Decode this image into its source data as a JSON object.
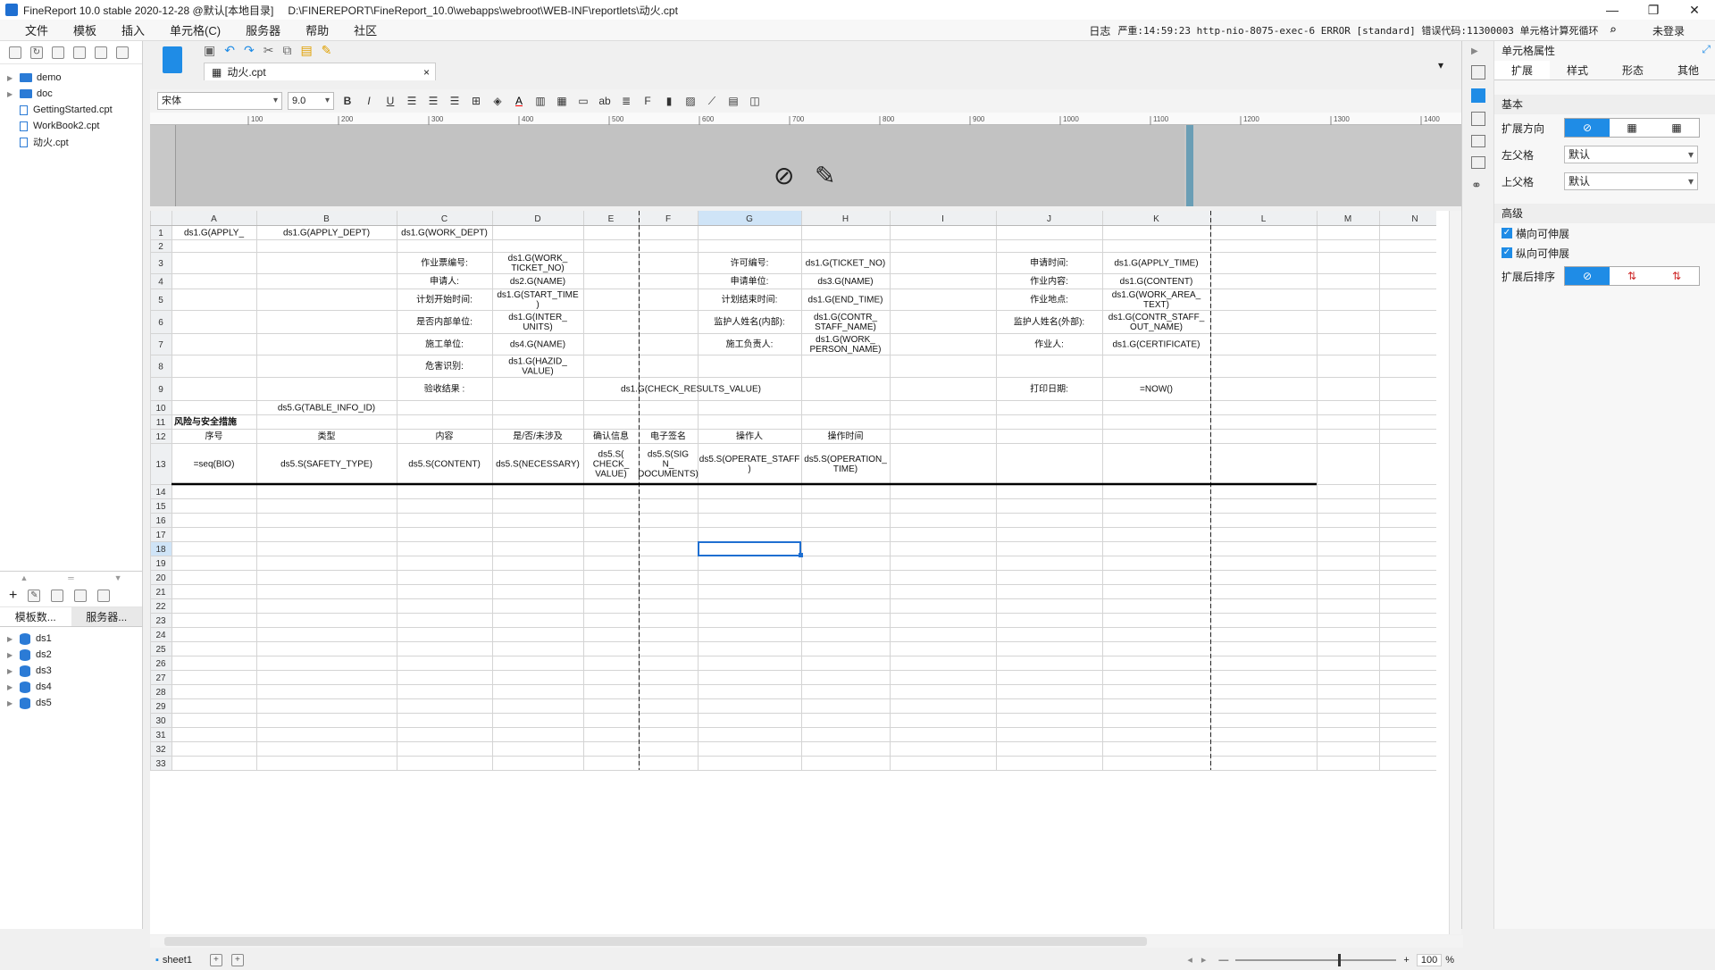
{
  "app": {
    "title": "FineReport 10.0 stable 2020-12-28 @默认[本地目录]",
    "path": "D:\\FINEREPORT\\FineReport_10.0\\webapps\\webroot\\WEB-INF\\reportlets\\动火.cpt"
  },
  "menu": [
    "文件",
    "模板",
    "插入",
    "单元格(C)",
    "服务器",
    "帮助",
    "社区"
  ],
  "status": {
    "log": "日志",
    "message": "严重:14:59:23 http-nio-8075-exec-6 ERROR [standard] 错误代码:11300003 单元格计算死循环",
    "login": "未登录"
  },
  "tree": [
    {
      "type": "folder",
      "label": "demo"
    },
    {
      "type": "folder",
      "label": "doc"
    },
    {
      "type": "file",
      "label": "GettingStarted.cpt"
    },
    {
      "type": "file",
      "label": "WorkBook2.cpt"
    },
    {
      "type": "file",
      "label": "动火.cpt"
    }
  ],
  "bottomTabs": [
    "模板数...",
    "服务器..."
  ],
  "datasets": [
    "ds1",
    "ds2",
    "ds3",
    "ds4",
    "ds5"
  ],
  "doc": {
    "tab": "动火.cpt",
    "close": "×"
  },
  "format": {
    "font": "宋体",
    "size": "9.0"
  },
  "ruler": [
    "100",
    "200",
    "300",
    "400",
    "500",
    "600",
    "700",
    "800",
    "900",
    "1000",
    "1100",
    "1200",
    "1300",
    "1400"
  ],
  "grid": {
    "columns": [
      "A",
      "B",
      "C",
      "D",
      "E",
      "F",
      "G",
      "H",
      "I",
      "J",
      "K",
      "L",
      "M",
      "N"
    ],
    "rows": [
      "1",
      "2",
      "3",
      "4",
      "5",
      "6",
      "7",
      "8",
      "9",
      "10",
      "11",
      "12",
      "13",
      "14",
      "15",
      "16",
      "17",
      "18",
      "19",
      "20",
      "21",
      "22",
      "23",
      "24",
      "25",
      "26",
      "27",
      "28",
      "29",
      "30",
      "31",
      "32",
      "33"
    ],
    "cells": [
      {
        "r": 0,
        "c": 0,
        "t": "ds1.G(APPLY_"
      },
      {
        "r": 0,
        "c": 1,
        "t": "ds1.G(APPLY_DEPT)"
      },
      {
        "r": 0,
        "c": 2,
        "t": "ds1.G(WORK_DEPT)"
      },
      {
        "r": 2,
        "c": 2,
        "t": "作业票编号:"
      },
      {
        "r": 2,
        "c": 3,
        "t": "ds1.G(WORK_|TICKET_NO)"
      },
      {
        "r": 2,
        "c": 6,
        "t": "许可编号:"
      },
      {
        "r": 2,
        "c": 7,
        "t": "ds1.G(TICKET_NO)"
      },
      {
        "r": 2,
        "c": 9,
        "t": "申请时间:"
      },
      {
        "r": 2,
        "c": 10,
        "t": "ds1.G(APPLY_TIME)"
      },
      {
        "r": 3,
        "c": 2,
        "t": "申请人:"
      },
      {
        "r": 3,
        "c": 3,
        "t": "ds2.G(NAME)"
      },
      {
        "r": 3,
        "c": 6,
        "t": "申请单位:"
      },
      {
        "r": 3,
        "c": 7,
        "t": "ds3.G(NAME)"
      },
      {
        "r": 3,
        "c": 9,
        "t": "作业内容:"
      },
      {
        "r": 3,
        "c": 10,
        "t": "ds1.G(CONTENT)"
      },
      {
        "r": 4,
        "c": 2,
        "t": "计划开始时间:"
      },
      {
        "r": 4,
        "c": 3,
        "t": "ds1.G(START_TIME|)"
      },
      {
        "r": 4,
        "c": 6,
        "t": "计划结束时间:"
      },
      {
        "r": 4,
        "c": 7,
        "t": "ds1.G(END_TIME)"
      },
      {
        "r": 4,
        "c": 9,
        "t": "作业地点:"
      },
      {
        "r": 4,
        "c": 10,
        "t": "ds1.G(WORK_AREA_|TEXT)"
      },
      {
        "r": 5,
        "c": 2,
        "t": "是否内部单位:"
      },
      {
        "r": 5,
        "c": 3,
        "t": "ds1.G(INTER_|UNITS)"
      },
      {
        "r": 5,
        "c": 6,
        "t": "监护人姓名(内部):"
      },
      {
        "r": 5,
        "c": 7,
        "t": "ds1.G(CONTR_|STAFF_NAME)"
      },
      {
        "r": 5,
        "c": 9,
        "t": "监护人姓名(外部):"
      },
      {
        "r": 5,
        "c": 10,
        "t": "ds1.G(CONTR_STAFF_|OUT_NAME)"
      },
      {
        "r": 6,
        "c": 2,
        "t": "施工单位:"
      },
      {
        "r": 6,
        "c": 3,
        "t": "ds4.G(NAME)"
      },
      {
        "r": 6,
        "c": 6,
        "t": "施工负责人:"
      },
      {
        "r": 6,
        "c": 7,
        "t": "ds1.G(WORK_|PERSON_NAME)"
      },
      {
        "r": 6,
        "c": 9,
        "t": "作业人:"
      },
      {
        "r": 6,
        "c": 10,
        "t": "ds1.G(CERTIFICATE)"
      },
      {
        "r": 7,
        "c": 2,
        "t": "危害识别:"
      },
      {
        "r": 7,
        "c": 3,
        "t": "ds1.G(HAZID_|VALUE)"
      },
      {
        "r": 8,
        "c": 2,
        "t": "验收结果 :"
      },
      {
        "r": 8,
        "c": 3,
        "t": "ds1.G(CHECK_RESULTS_VALUE)",
        "span": 5
      },
      {
        "r": 8,
        "c": 9,
        "t": "打印日期:"
      },
      {
        "r": 8,
        "c": 10,
        "t": "=NOW()"
      },
      {
        "r": 9,
        "c": 1,
        "t": "ds5.G(TABLE_INFO_ID)"
      },
      {
        "r": 10,
        "c": 0,
        "t": "风险与安全措施",
        "bold": true,
        "left": true
      },
      {
        "r": 11,
        "c": 0,
        "t": "序号"
      },
      {
        "r": 11,
        "c": 1,
        "t": "类型"
      },
      {
        "r": 11,
        "c": 2,
        "t": "内容"
      },
      {
        "r": 11,
        "c": 3,
        "t": "是/否/未涉及"
      },
      {
        "r": 11,
        "c": 4,
        "t": "确认信息"
      },
      {
        "r": 11,
        "c": 5,
        "t": "电子签名"
      },
      {
        "r": 11,
        "c": 6,
        "t": "操作人"
      },
      {
        "r": 11,
        "c": 7,
        "t": "操作时间"
      },
      {
        "r": 12,
        "c": 0,
        "t": "=seq(BIO)"
      },
      {
        "r": 12,
        "c": 1,
        "t": "ds5.S(SAFETY_TYPE)"
      },
      {
        "r": 12,
        "c": 2,
        "t": "ds5.S(CONTENT)"
      },
      {
        "r": 12,
        "c": 3,
        "t": "ds5.S(NECESSARY)"
      },
      {
        "r": 12,
        "c": 4,
        "t": "ds5.S(|CHECK_|VALUE)"
      },
      {
        "r": 12,
        "c": 5,
        "t": "ds5.S(SIG|N_|DOCUMENTS)"
      },
      {
        "r": 12,
        "c": 6,
        "t": "ds5.S(OPERATE_STAFF|)"
      },
      {
        "r": 12,
        "c": 7,
        "t": "ds5.S(OPERATION_|TIME)"
      }
    ]
  },
  "sheet": {
    "name": "sheet1",
    "zoom": "100",
    "pct": "%"
  },
  "panel": {
    "title": "单元格属性",
    "tabs": [
      "扩展",
      "样式",
      "形态",
      "其他"
    ],
    "basic": "基本",
    "expandDir": "扩展方向",
    "leftParent": "左父格",
    "leftVal": "默认",
    "upParent": "上父格",
    "upVal": "默认",
    "advanced": "高级",
    "hExpand": "横向可伸展",
    "vExpand": "纵向可伸展",
    "sortAfter": "扩展后排序"
  },
  "colors": {
    "accent": "#1f8ce6",
    "selection": "#1f6fd1"
  }
}
